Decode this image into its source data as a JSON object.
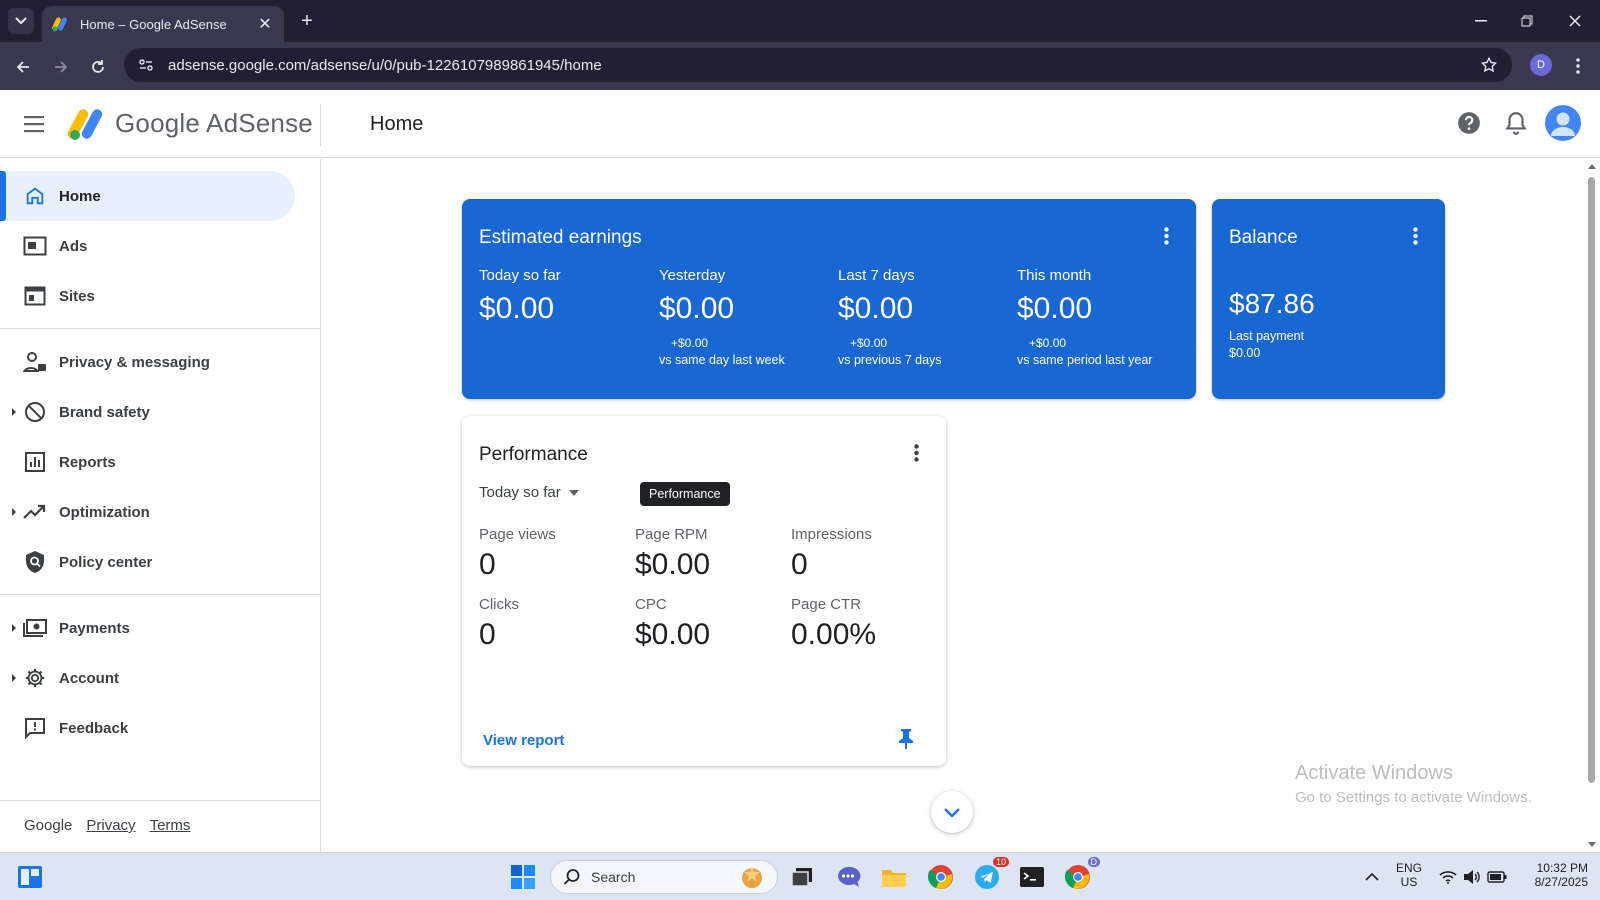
{
  "browser": {
    "tab_title": "Home – Google AdSense",
    "url": "adsense.google.com/adsense/u/0/pub-1226107989861945/home",
    "profile_initial": "D"
  },
  "header": {
    "brand": "Google AdSense",
    "page_title": "Home"
  },
  "sidebar": {
    "items": [
      {
        "label": "Home"
      },
      {
        "label": "Ads"
      },
      {
        "label": "Sites"
      },
      {
        "label": "Privacy & messaging"
      },
      {
        "label": "Brand safety"
      },
      {
        "label": "Reports"
      },
      {
        "label": "Optimization"
      },
      {
        "label": "Policy center"
      },
      {
        "label": "Payments"
      },
      {
        "label": "Account"
      },
      {
        "label": "Feedback"
      }
    ],
    "footer": {
      "google": "Google",
      "privacy": "Privacy",
      "terms": "Terms"
    }
  },
  "earnings": {
    "title": "Estimated earnings",
    "metrics": [
      {
        "label": "Today so far",
        "value": "$0.00",
        "delta": "",
        "cmp": ""
      },
      {
        "label": "Yesterday",
        "value": "$0.00",
        "delta": "+$0.00",
        "cmp": "vs same day last week"
      },
      {
        "label": "Last 7 days",
        "value": "$0.00",
        "delta": "+$0.00",
        "cmp": "vs previous 7 days"
      },
      {
        "label": "This month",
        "value": "$0.00",
        "delta": "+$0.00",
        "cmp": "vs same period last year"
      }
    ]
  },
  "balance": {
    "title": "Balance",
    "amount": "$87.86",
    "last_payment_label": "Last payment",
    "last_payment_value": "$0.00"
  },
  "performance": {
    "title": "Performance",
    "range": "Today so far",
    "tooltip": "Performance",
    "metrics": [
      {
        "label": "Page views",
        "value": "0"
      },
      {
        "label": "Page RPM",
        "value": "$0.00"
      },
      {
        "label": "Impressions",
        "value": "0"
      },
      {
        "label": "Clicks",
        "value": "0"
      },
      {
        "label": "CPC",
        "value": "$0.00"
      },
      {
        "label": "Page CTR",
        "value": "0.00%"
      }
    ],
    "view_report": "View report"
  },
  "watermark": {
    "line1": "Activate Windows",
    "line2": "Go to Settings to activate Windows."
  },
  "taskbar": {
    "search_placeholder": "Search",
    "telegram_badge": "10",
    "chrome_badge": "D",
    "lang_line1": "ENG",
    "lang_line2": "US",
    "time": "10:32 PM",
    "date": "8/27/2025"
  },
  "colors": {
    "accent": "#1a73e8",
    "card_blue": "#1967d2",
    "active_nav": "#e8f0fe"
  }
}
